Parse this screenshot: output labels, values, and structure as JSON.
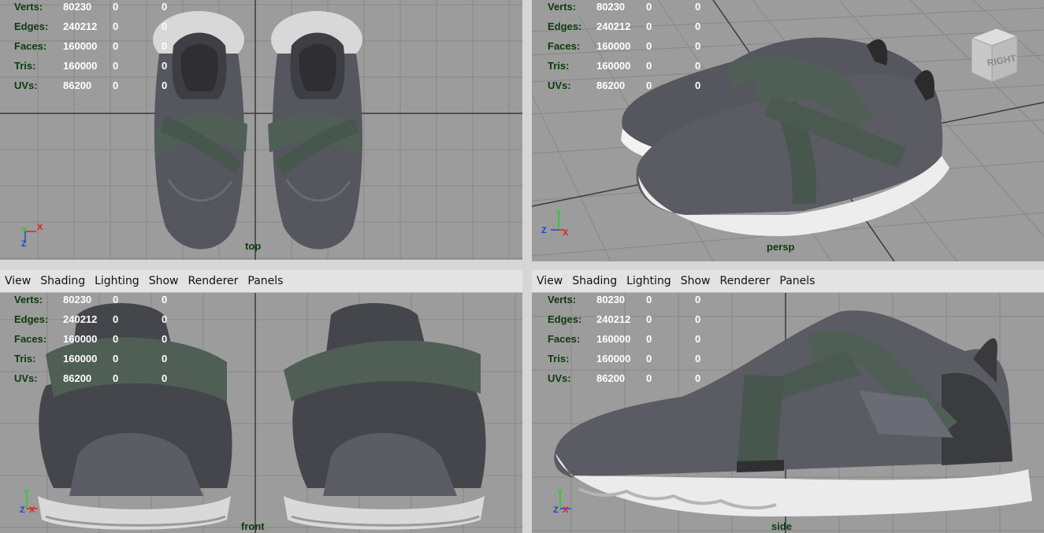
{
  "menu": [
    "View",
    "Shading",
    "Lighting",
    "Show",
    "Renderer",
    "Panels"
  ],
  "hud": {
    "rows": [
      {
        "label": "Verts:",
        "total": "80230",
        "selected": "0",
        "tri_selected": "0"
      },
      {
        "label": "Edges:",
        "total": "240212",
        "selected": "0",
        "tri_selected": "0"
      },
      {
        "label": "Faces:",
        "total": "160000",
        "selected": "0",
        "tri_selected": "0"
      },
      {
        "label": "Tris:",
        "total": "160000",
        "selected": "0",
        "tri_selected": "0"
      },
      {
        "label": "UVs:",
        "total": "86200",
        "selected": "0",
        "tri_selected": "0"
      }
    ]
  },
  "viewports": {
    "top": {
      "camera": "top"
    },
    "persp": {
      "camera": "persp",
      "viewcube": "RIGHT"
    },
    "front": {
      "camera": "front"
    },
    "side": {
      "camera": "side"
    }
  },
  "axis_labels": {
    "x": "X",
    "y": "Y",
    "z": "Z"
  },
  "colors": {
    "viewport_bg": "#9c9c9c",
    "grid": "#878787",
    "hud_label": "#0d3b0d",
    "hud_value": "#ffffff",
    "axis_x": "#e02020",
    "axis_y": "#20d020",
    "axis_z": "#2040e0",
    "shoe_upper": "#55565e",
    "shoe_strap": "#4f5f56",
    "sole": "#e8e8e8"
  }
}
